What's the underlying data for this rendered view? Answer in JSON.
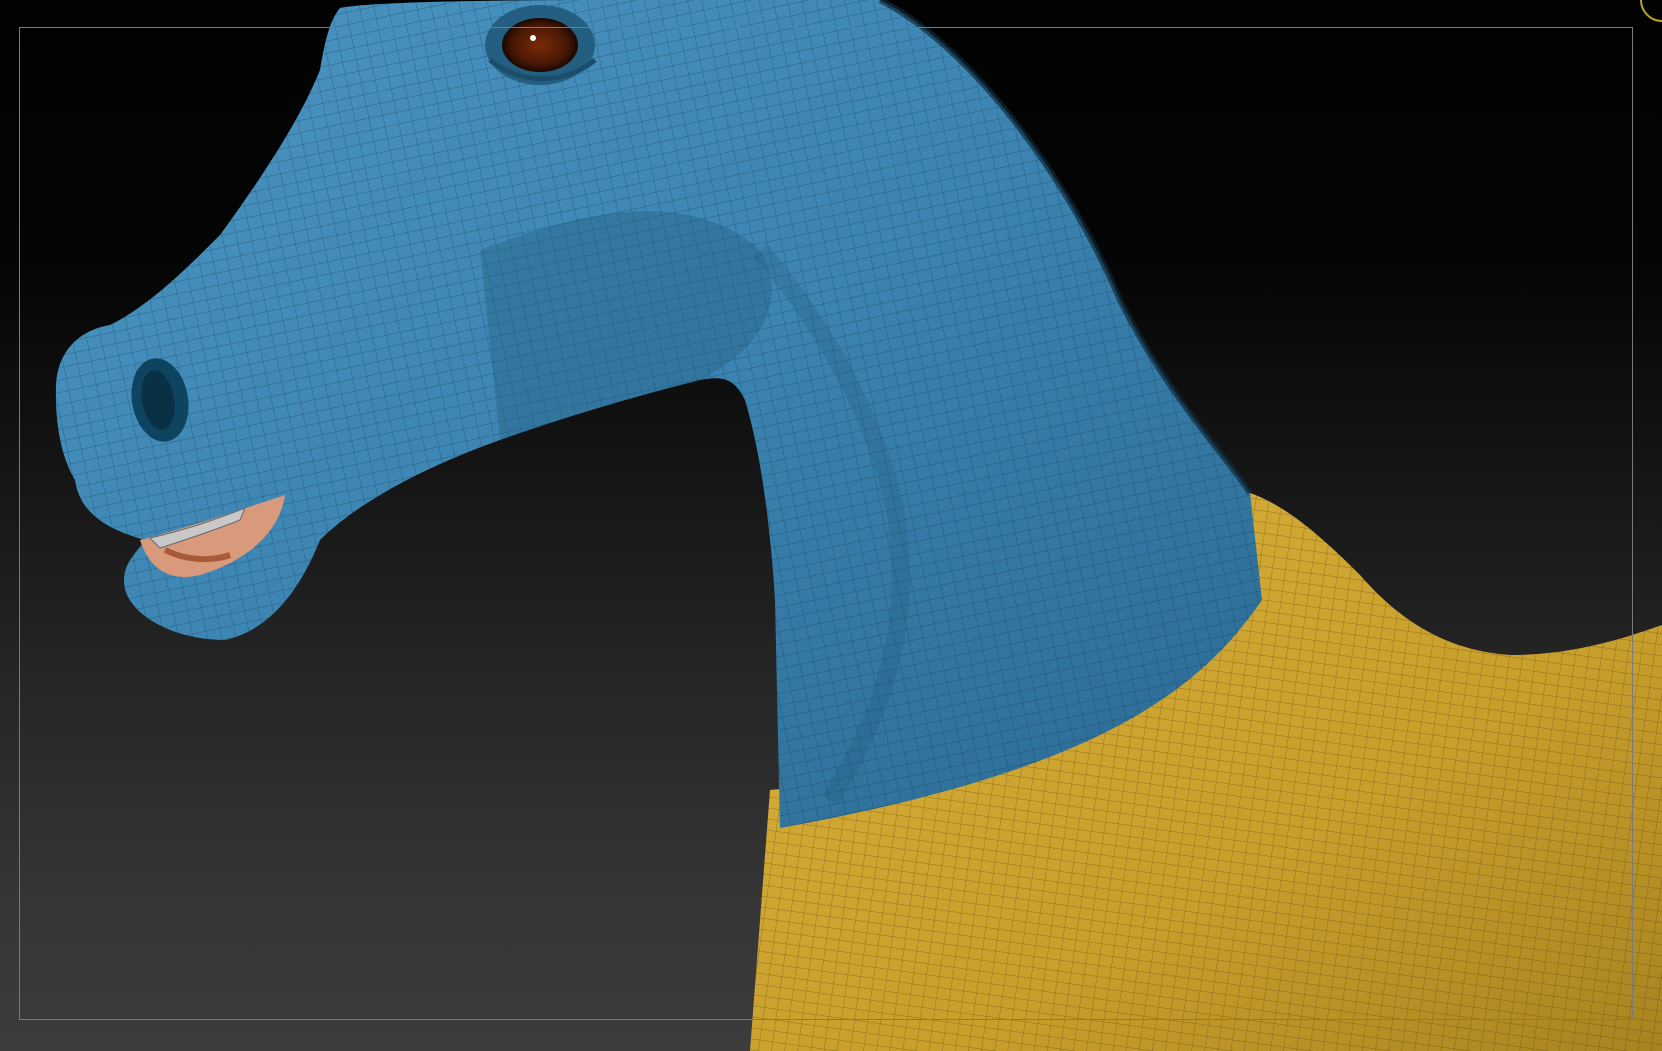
{
  "app": {
    "view": "3d-viewport"
  },
  "model": {
    "subject": "horse-head-and-neck",
    "colors": {
      "upper": "#3d86b4",
      "upper_shadow": "#1f5878",
      "lower": "#d3ab35",
      "lower_shadow": "#8d6d16",
      "wire": "#0b1820"
    }
  },
  "gizmo": {
    "icon": "orientation-gizmo-icon",
    "color": "#b8a623"
  },
  "frame": {
    "color": "#7a7a7a"
  }
}
